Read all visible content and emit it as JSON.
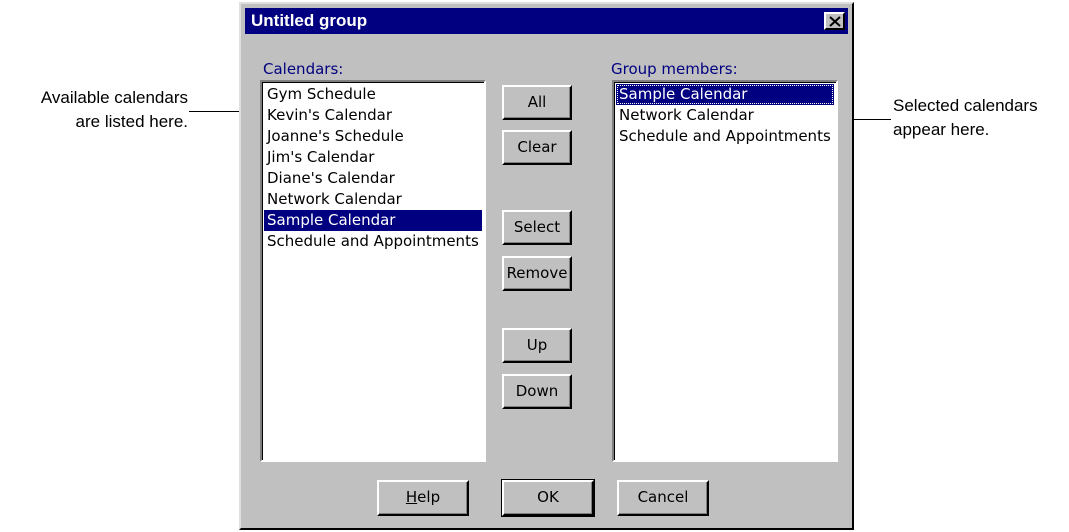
{
  "callouts": {
    "left": [
      "Available calendars",
      "are listed here."
    ],
    "right": [
      "Selected calendars",
      "appear here."
    ]
  },
  "dialog": {
    "title": "Untitled group",
    "close_icon": "close-icon",
    "calendars_label": "Calendars:",
    "members_label": "Group members:",
    "calendars": [
      {
        "label": "Gym Schedule",
        "selected": false
      },
      {
        "label": "Kevin's Calendar",
        "selected": false
      },
      {
        "label": "Joanne's Schedule",
        "selected": false
      },
      {
        "label": "Jim's Calendar",
        "selected": false
      },
      {
        "label": "Diane's Calendar",
        "selected": false
      },
      {
        "label": "Network Calendar",
        "selected": false
      },
      {
        "label": "Sample Calendar",
        "selected": true
      },
      {
        "label": "Schedule and Appointments",
        "selected": false
      }
    ],
    "members": [
      {
        "label": "Sample Calendar",
        "selected": true
      },
      {
        "label": "Network Calendar",
        "selected": false
      },
      {
        "label": "Schedule and Appointments",
        "selected": false
      }
    ],
    "buttons": {
      "all": "All",
      "clear": "Clear",
      "select": "Select",
      "remove": "Remove",
      "up": "Up",
      "down": "Down"
    },
    "bottom_buttons": {
      "help_mnemonic": "H",
      "help_rest": "elp",
      "ok": "OK",
      "cancel": "Cancel"
    }
  },
  "colors": {
    "dialog_face": "#c0c0c0",
    "title_bar": "#000080",
    "selection": "#000080",
    "label_text": "#000080"
  }
}
